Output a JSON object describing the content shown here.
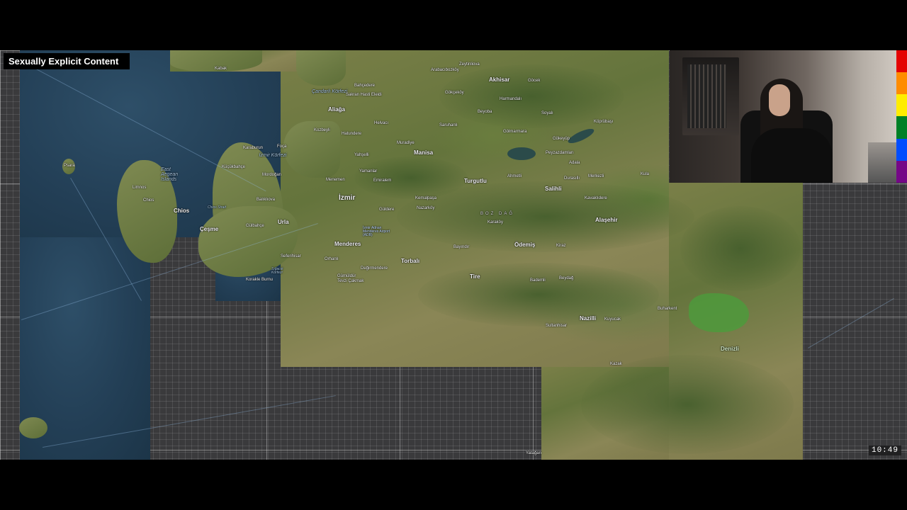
{
  "content_warning": "Sexually Explicit Content",
  "timer": "10:49",
  "pride_colors": [
    "#e40303",
    "#ff8c00",
    "#ffed00",
    "#008026",
    "#004dff",
    "#750787"
  ],
  "places": {
    "Sea": "Sea",
    "Kabak": "Kabak",
    "aliaga": "Aliağa",
    "candarli": "Çandarlı Körfezi",
    "bahcedere": "Bahçedere",
    "sakran": "Sakran Hasti Eleidi",
    "helvaci": "Helvacı",
    "hatundere": "Hatundere",
    "kozbeyli": "Kozbeyli",
    "foca": "Foça",
    "karaburun": "Karaburun",
    "izmir_korfezi": "İzmir Körfezi",
    "kucukbahce": "Küçükbahçe",
    "mordogan": "Mordoğan",
    "east_aegean": "East Aegean Islands",
    "limnos": "Limnos",
    "chios_island": "Chios",
    "chios_town": "Chios",
    "psara": "Psara",
    "chios_strait": "Chios Strait",
    "cesme": "Çeşme",
    "urla": "Urla",
    "balikliova": "Balıklıova",
    "gulbahce": "Gülbahçe",
    "izmir": "İzmir",
    "menemen": "Menemen",
    "yahselli": "Yahşelli",
    "yamanlar": "Yamanlar",
    "manisa": "Manisa",
    "muradiye": "Muradiye",
    "emiralem": "Emiralem",
    "akhisar": "Akhisar",
    "gocek": "Göcek",
    "zeytinliova": "Zeytinliova",
    "arabacibozkoy": "Arabacıbozköy",
    "gokcekoy": "Gökçeköy",
    "harmandali": "Harmandalı",
    "saruhanli": "Saruhanlı",
    "golmarmara": "Gölmarmara",
    "beyoba": "Beyoba",
    "soyali": "Soyalı",
    "koprubasi": "Köprübaşı",
    "gokeyup": "Gökeyüp",
    "peyzazdamlari": "Peyzazdamları",
    "turgutlu": "Turgutlu",
    "ahmetli": "Ahmetli",
    "salihli": "Salihli",
    "adala": "Adala",
    "durasilli": "Durasıllı",
    "merkezli": "Merkezli",
    "kula": "Kula",
    "kemalpasa": "Kemalpaşa",
    "nazarkoy": "Nazarköy",
    "guldere": "Güldere",
    "bozdag": "BOZ DAĞ",
    "karakoy": "Karaköy",
    "kavaklidere": "Kavaklıdere",
    "alasehir": "Alaşehir",
    "airport": "İzmir Adnan Menderes Airport (ADB)",
    "menderes": "Menderes",
    "bayindir": "Bayındır",
    "odemis": "Ödemiş",
    "kiraz": "Kiraz",
    "torbali": "Torbalı",
    "seferihisar": "Seferihisar",
    "sigacik": "Sığacık Körfezi",
    "orhanli": "Orhanlı",
    "degirmendere": "Değirmendere",
    "gumuldur": "Gümüldür",
    "tevzi": "Tevzi Çakmak",
    "tire": "Tire",
    "kusadasi_bay": "Korakle Burnu",
    "beydag": "Beydağ",
    "bademli": "Bademli",
    "nazilli": "Nazilli",
    "kuyucak": "Kuyucak",
    "sultanhisar": "Sultanhisar",
    "buharkent": "Buharkent",
    "denizli": "Denizli",
    "yataga": "Yatağan",
    "kazak": "Kazak"
  }
}
